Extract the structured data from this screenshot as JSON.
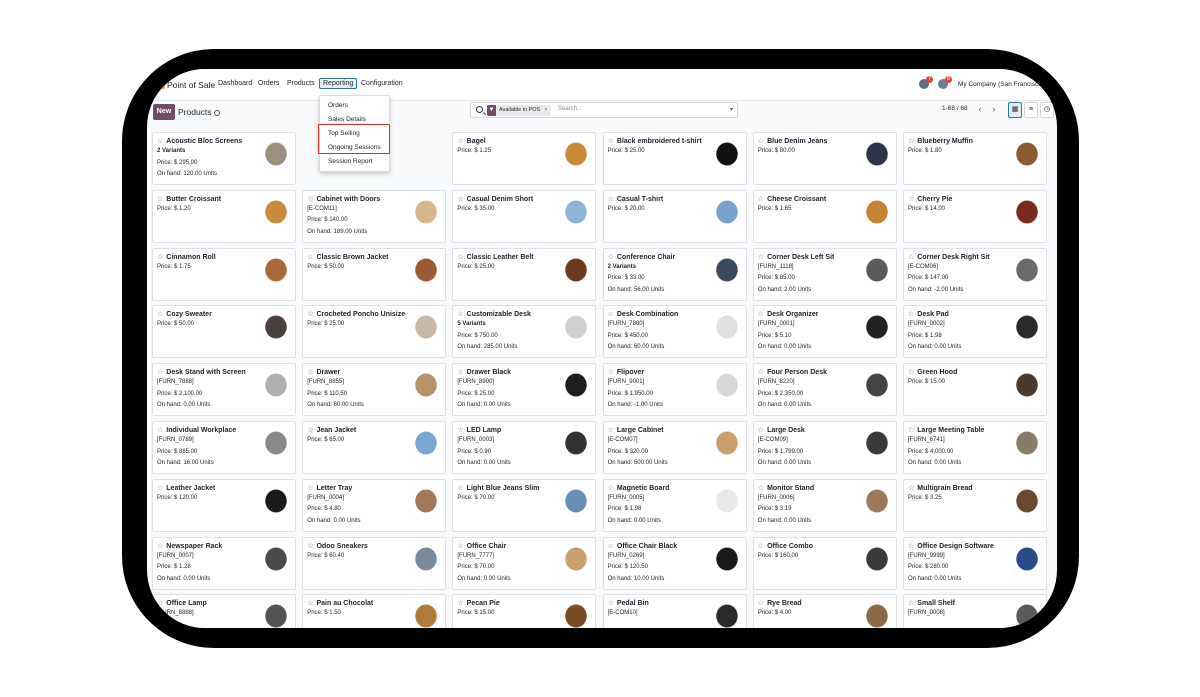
{
  "topbar": {
    "app_title": "Point of Sale",
    "menus": [
      "Dashboard",
      "Orders",
      "Products",
      "Reporting",
      "Configuration"
    ],
    "active_menu": "Reporting",
    "chat_badge": "7",
    "activity_badge": "8",
    "company": "My Company (San Francisco)"
  },
  "control_panel": {
    "new_label": "New",
    "breadcrumb": "Products",
    "facet_label": "Available in POS",
    "facet_remove": "×",
    "search_placeholder": "Search...",
    "pager": "1-68 / 68"
  },
  "reporting_menu": {
    "items": [
      "Orders",
      "Sales Details",
      "Top Selling",
      "Ongoing Sessions",
      "Session Report"
    ]
  },
  "products": [
    {
      "name": "Acoustic Bloc Screens",
      "l1": "2 Variants",
      "l2": "Price: $ 295.00",
      "l3": "On hand: 120.00 Units",
      "img": "#9c8f7e"
    },
    {
      "name": "",
      "l1": "",
      "l2": "",
      "l3": "",
      "img": ""
    },
    {
      "name": "Bagel",
      "l1": "Price: $ 1.25",
      "l2": "",
      "l3": "",
      "img": "#c98a3a"
    },
    {
      "name": "Black embroidered t-shirt",
      "l1": "Price: $ 25.00",
      "l2": "",
      "l3": "",
      "img": "#111111"
    },
    {
      "name": "Blue Denim Jeans",
      "l1": "Price: $ 80.00",
      "l2": "",
      "l3": "",
      "img": "#2a3548"
    },
    {
      "name": "Blueberry Muffin",
      "l1": "Price: $ 1.80",
      "l2": "",
      "l3": "",
      "img": "#8a5a33"
    },
    {
      "name": "Butter Croissant",
      "l1": "Price: $ 1.20",
      "l2": "",
      "l3": "",
      "img": "#c88b3c"
    },
    {
      "name": "Cabinet with Doors",
      "l1": "[E-COM11]",
      "l2": "Price: $ 140.00",
      "l3": "On hand: 189.00 Units",
      "img": "#d6b58f"
    },
    {
      "name": "Casual Denim Short",
      "l1": "Price: $ 35.00",
      "l2": "",
      "l3": "",
      "img": "#8fb3d6"
    },
    {
      "name": "Casual T-shirt",
      "l1": "Price: $ 20.00",
      "l2": "",
      "l3": "",
      "img": "#7aa1c9"
    },
    {
      "name": "Cheese Croissant",
      "l1": "Price: $ 1.65",
      "l2": "",
      "l3": "",
      "img": "#c48335"
    },
    {
      "name": "Cherry Pie",
      "l1": "Price: $ 14.00",
      "l2": "",
      "l3": "",
      "img": "#7a2a1f"
    },
    {
      "name": "Cinnamon Roll",
      "l1": "Price: $ 1.75",
      "l2": "",
      "l3": "",
      "img": "#a86a3a"
    },
    {
      "name": "Classic Brown Jacket",
      "l1": "Price: $ 50.00",
      "l2": "",
      "l3": "",
      "img": "#9a5a34"
    },
    {
      "name": "Classic Leather Belt",
      "l1": "Price: $ 25.00",
      "l2": "",
      "l3": "",
      "img": "#6b3a1e"
    },
    {
      "name": "Conference Chair",
      "l1": "2 Variants",
      "l2": "Price: $ 33.00",
      "l3": "On hand: 56.00 Units",
      "img": "#3a4a5a"
    },
    {
      "name": "Corner Desk Left Sit",
      "l1": "[FURN_1118]",
      "l2": "Price: $ 85.00",
      "l3": "On hand: 2.00 Units",
      "img": "#5a5a5a"
    },
    {
      "name": "Corner Desk Right Sit",
      "l1": "[E-COM06]",
      "l2": "Price: $ 147.00",
      "l3": "On hand: -2.00 Units",
      "img": "#6a6a6a"
    },
    {
      "name": "Cozy Sweater",
      "l1": "Price: $ 50.00",
      "l2": "",
      "l3": "",
      "img": "#4a4040"
    },
    {
      "name": "Crocheted Poncho Unisize",
      "l1": "Price: $ 25.00",
      "l2": "",
      "l3": "",
      "img": "#c9b8a8"
    },
    {
      "name": "Customizable Desk",
      "l1": "5 Variants",
      "l2": "Price: $ 750.00",
      "l3": "On hand: 285.00 Units",
      "img": "#d0d0d0"
    },
    {
      "name": "Desk Combination",
      "l1": "[FURN_7800]",
      "l2": "Price: $ 450.00",
      "l3": "On hand: 60.00 Units",
      "img": "#e0e0e0"
    },
    {
      "name": "Desk Organizer",
      "l1": "[FURN_0001]",
      "l2": "Price: $ 5.10",
      "l3": "On hand: 0.00 Units",
      "img": "#222222"
    },
    {
      "name": "Desk Pad",
      "l1": "[FURN_0002]",
      "l2": "Price: $ 1.98",
      "l3": "On hand: 0.00 Units",
      "img": "#2a2a2a"
    },
    {
      "name": "Desk Stand with Screen",
      "l1": "[FURN_7888]",
      "l2": "Price: $ 2,100.00",
      "l3": "On hand: 0.00 Units",
      "img": "#b0b0b0"
    },
    {
      "name": "Drawer",
      "l1": "[FURN_8855]",
      "l2": "Price: $ 110.50",
      "l3": "On hand: 80.00 Units",
      "img": "#b8926a"
    },
    {
      "name": "Drawer Black",
      "l1": "[FURN_8900]",
      "l2": "Price: $ 25.00",
      "l3": "On hand: 0.00 Units",
      "img": "#1e1e1e"
    },
    {
      "name": "Flipover",
      "l1": "[FURN_9001]",
      "l2": "Price: $ 1,950.00",
      "l3": "On hand: -1.00 Units",
      "img": "#d8d8d8"
    },
    {
      "name": "Four Person Desk",
      "l1": "[FURN_8220]",
      "l2": "Price: $ 2,350.00",
      "l3": "On hand: 0.00 Units",
      "img": "#444444"
    },
    {
      "name": "Green Hood",
      "l1": "Price: $ 15.00",
      "l2": "",
      "l3": "",
      "img": "#4a3a2e"
    },
    {
      "name": "Individual Workplace",
      "l1": "[FURN_0789]",
      "l2": "Price: $ 885.00",
      "l3": "On hand: 16.00 Units",
      "img": "#8a8a8a"
    },
    {
      "name": "Jean Jacket",
      "l1": "Price: $ 65.00",
      "l2": "",
      "l3": "",
      "img": "#7aa6cf"
    },
    {
      "name": "LED Lamp",
      "l1": "[FURN_0003]",
      "l2": "Price: $ 0.90",
      "l3": "On hand: 0.00 Units",
      "img": "#333333"
    },
    {
      "name": "Large Cabinet",
      "l1": "[E-COM07]",
      "l2": "Price: $ 320.00",
      "l3": "On hand: 500.00 Units",
      "img": "#c9a06c"
    },
    {
      "name": "Large Desk",
      "l1": "[E-COM09]",
      "l2": "Price: $ 1,799.00",
      "l3": "On hand: 0.00 Units",
      "img": "#3a3a3a"
    },
    {
      "name": "Large Meeting Table",
      "l1": "[FURN_6741]",
      "l2": "Price: $ 4,000.00",
      "l3": "On hand: 0.00 Units",
      "img": "#8a7a6a"
    },
    {
      "name": "Leather Jacket",
      "l1": "Price: $ 120.00",
      "l2": "",
      "l3": "",
      "img": "#1a1a1a"
    },
    {
      "name": "Letter Tray",
      "l1": "[FURN_0004]",
      "l2": "Price: $ 4.80",
      "l3": "On hand: 0.00 Units",
      "img": "#a0785a"
    },
    {
      "name": "Light Blue Jeans Slim",
      "l1": "Price: $ 70.00",
      "l2": "",
      "l3": "",
      "img": "#6a8fb5"
    },
    {
      "name": "Magnetic Board",
      "l1": "[FURN_0005]",
      "l2": "Price: $ 1.98",
      "l3": "On hand: 0.00 Units",
      "img": "#e8e8e8"
    },
    {
      "name": "Monitor Stand",
      "l1": "[FURN_0006]",
      "l2": "Price: $ 3.19",
      "l3": "On hand: 0.00 Units",
      "img": "#9a7a5a"
    },
    {
      "name": "Multigrain Bread",
      "l1": "Price: $ 3.25",
      "l2": "",
      "l3": "",
      "img": "#6a4a2e"
    },
    {
      "name": "Newspaper Rack",
      "l1": "[FURN_0007]",
      "l2": "Price: $ 1.28",
      "l3": "On hand: 0.00 Units",
      "img": "#4a4a4a"
    },
    {
      "name": "Odoo Sneakers",
      "l1": "Price: $ 60.40",
      "l2": "",
      "l3": "",
      "img": "#7a8a9a"
    },
    {
      "name": "Office Chair",
      "l1": "[FURN_7777]",
      "l2": "Price: $ 70.00",
      "l3": "On hand: 0.00 Units",
      "img": "#c8a070"
    },
    {
      "name": "Office Chair Black",
      "l1": "[FURN_0269]",
      "l2": "Price: $ 120.50",
      "l3": "On hand: 10.00 Units",
      "img": "#1a1a1a"
    },
    {
      "name": "Office Combo",
      "l1": "Price: $ 160.00",
      "l2": "",
      "l3": "",
      "img": "#3a3a3a"
    },
    {
      "name": "Office Design Software",
      "l1": "[FURN_9999]",
      "l2": "Price: $ 280.00",
      "l3": "On hand: 0.00 Units",
      "img": "#2a4a8a"
    },
    {
      "name": "Office Lamp",
      "l1": "[FURN_8888]",
      "l2": "",
      "l3": "",
      "img": "#555555"
    },
    {
      "name": "Pain au Chocolat",
      "l1": "Price: $ 1.50",
      "l2": "",
      "l3": "",
      "img": "#b07a3a"
    },
    {
      "name": "Pecan Pie",
      "l1": "Price: $ 15.00",
      "l2": "",
      "l3": "",
      "img": "#7a4a22"
    },
    {
      "name": "Pedal Bin",
      "l1": "[E-COM10]",
      "l2": "",
      "l3": "",
      "img": "#2a2a2a"
    },
    {
      "name": "Rye Bread",
      "l1": "Price: $ 4.00",
      "l2": "",
      "l3": "",
      "img": "#8a6a4a"
    },
    {
      "name": "Small Shelf",
      "l1": "[FURN_0008]",
      "l2": "",
      "l3": "",
      "img": "#5a5a5a"
    }
  ]
}
